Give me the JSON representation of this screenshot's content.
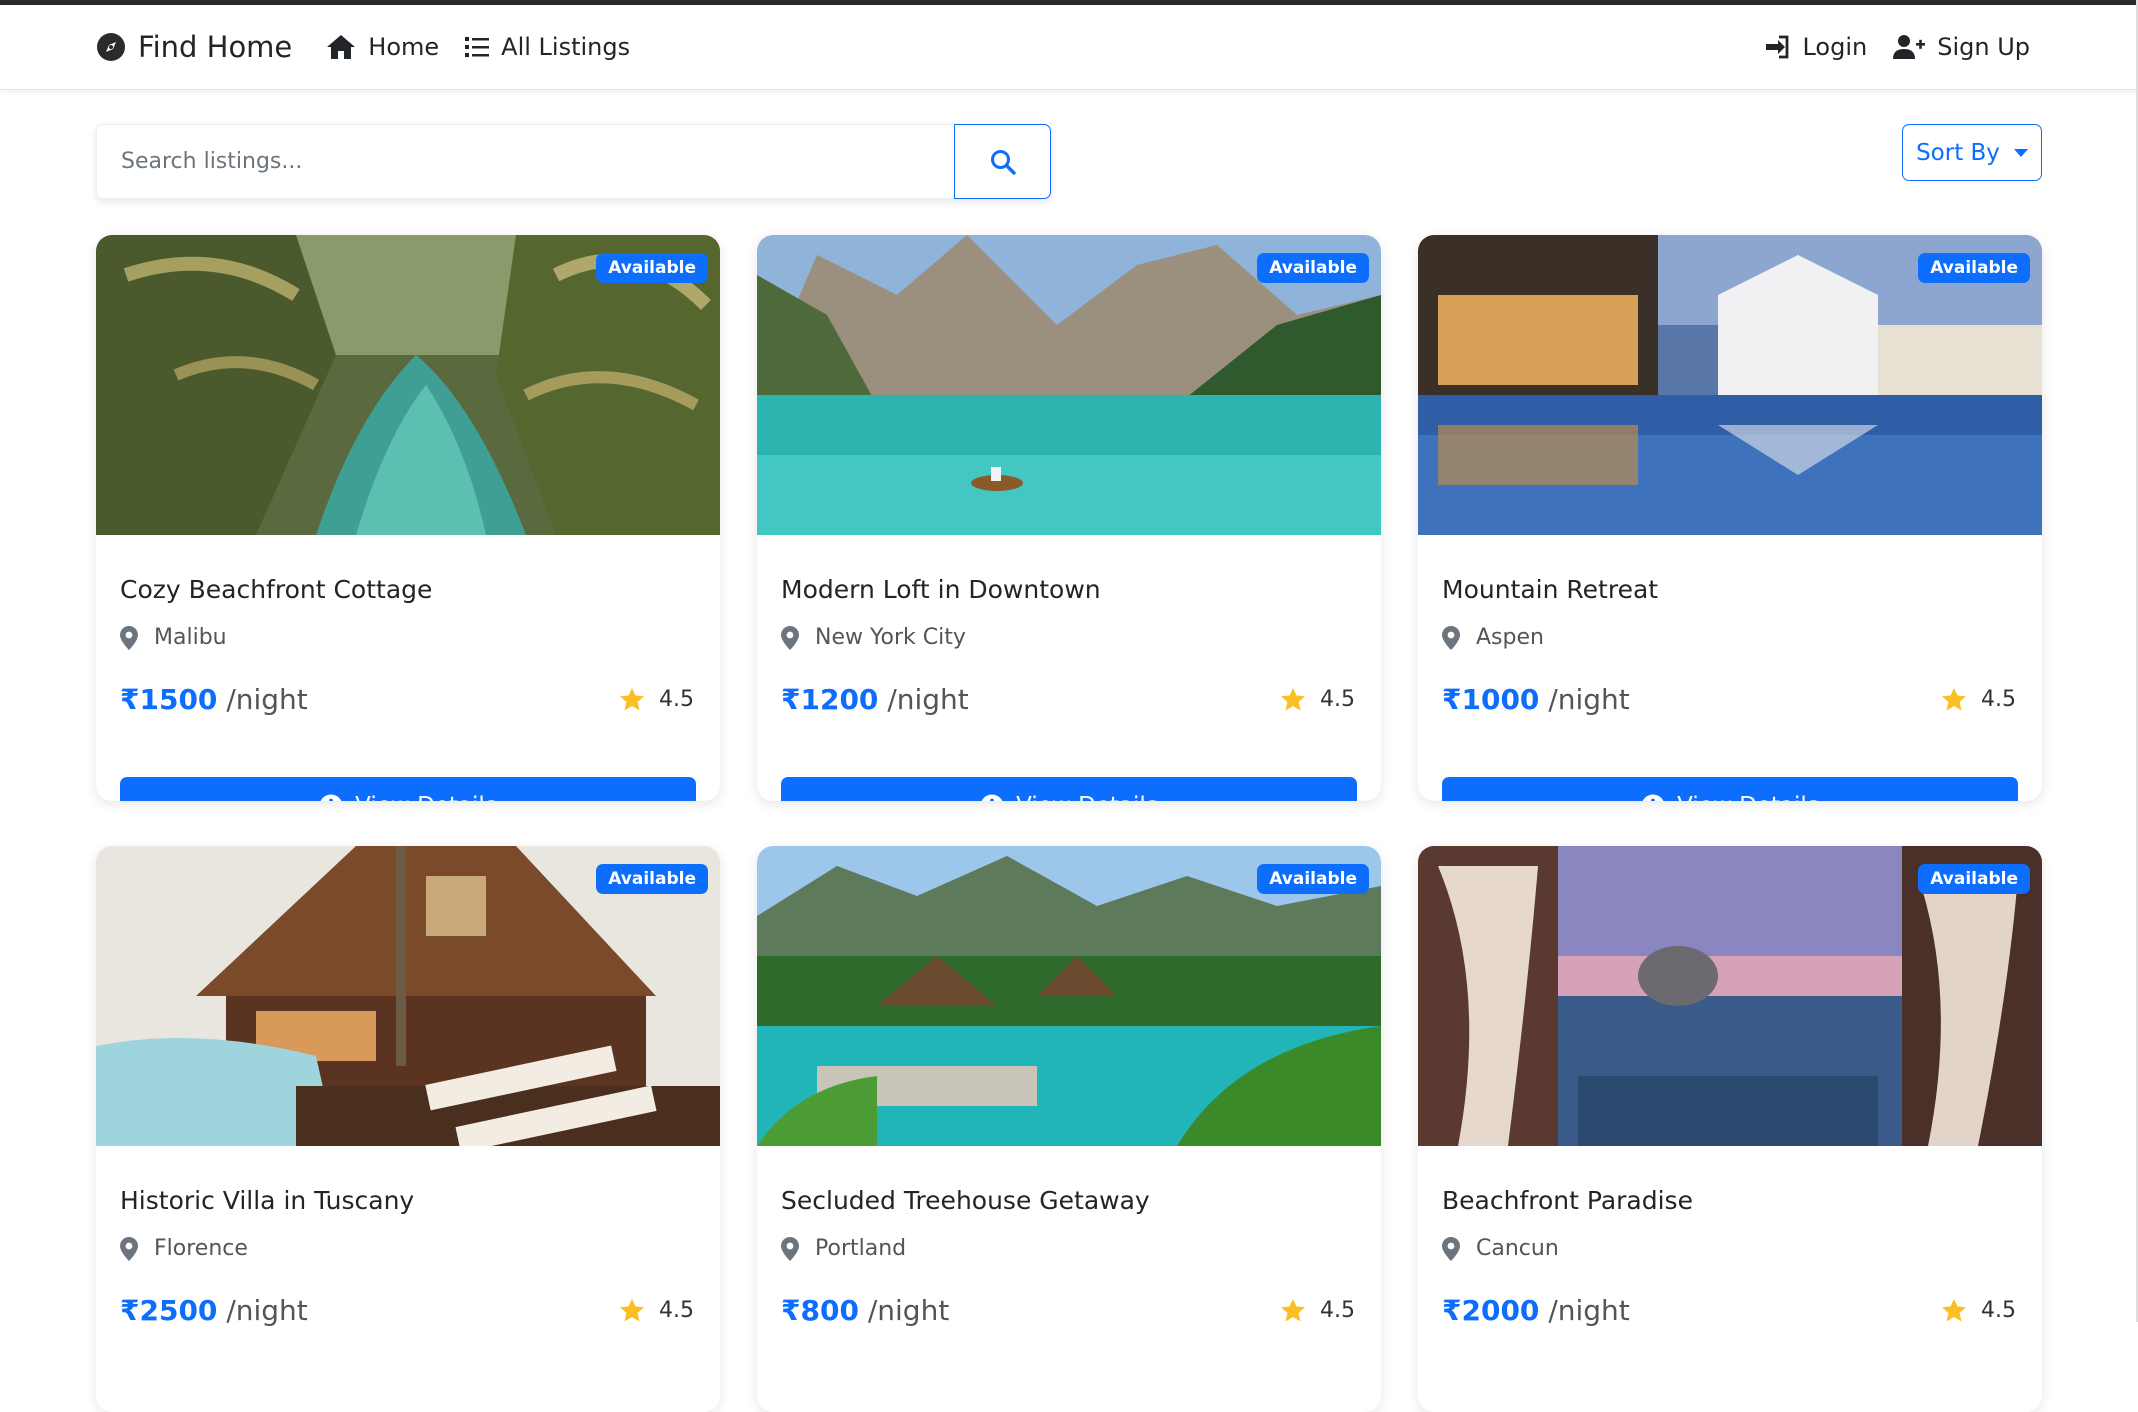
{
  "nav": {
    "brand": "Find Home",
    "home": "Home",
    "all_listings": "All Listings",
    "login": "Login",
    "signup": "Sign Up"
  },
  "search": {
    "placeholder": "Search listings..."
  },
  "sort": {
    "label": "Sort By"
  },
  "colors": {
    "primary": "#0d6efd",
    "star": "#fbbf24"
  },
  "listings": [
    {
      "title": "Cozy Beachfront Cottage",
      "location": "Malibu",
      "price": "₹1500",
      "per": "/night",
      "rating": "4.5",
      "badge": "Available",
      "image": "tropical-lagoon-palms"
    },
    {
      "title": "Modern Loft in Downtown",
      "location": "New York City",
      "price": "₹1200",
      "per": "/night",
      "rating": "4.5",
      "badge": "Available",
      "image": "mountain-lake-boat"
    },
    {
      "title": "Mountain Retreat",
      "location": "Aspen",
      "price": "₹1000",
      "per": "/night",
      "rating": "4.5",
      "badge": "Available",
      "image": "resort-pool-night"
    },
    {
      "title": "Historic Villa in Tuscany",
      "location": "Florence",
      "price": "₹2500",
      "per": "/night",
      "rating": "4.5",
      "badge": "Available",
      "image": "wooden-villa-pool"
    },
    {
      "title": "Secluded Treehouse Getaway",
      "location": "Portland",
      "price": "₹800",
      "per": "/night",
      "rating": "4.5",
      "badge": "Available",
      "image": "jungle-pool-huts"
    },
    {
      "title": "Beachfront Paradise",
      "location": "Cancun",
      "price": "₹2000",
      "per": "/night",
      "rating": "4.5",
      "badge": "Available",
      "image": "cabana-sunset-sea"
    }
  ],
  "view_details_label": "View Details"
}
